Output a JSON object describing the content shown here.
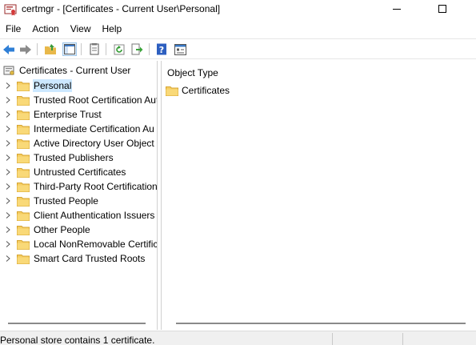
{
  "window": {
    "title": "certmgr - [Certificates - Current User\\Personal]"
  },
  "menu": [
    "File",
    "Action",
    "View",
    "Help"
  ],
  "toolbar": {
    "buttons": [
      "back-icon",
      "forward-icon",
      "up-folder-icon",
      "show-hide-console-tree-icon",
      "export-list-icon",
      "refresh-icon",
      "export-icon",
      "help-icon",
      "properties-icon"
    ]
  },
  "tree": {
    "root": "Certificates - Current User",
    "items": [
      {
        "label": "Personal",
        "selected": true
      },
      {
        "label": "Trusted Root Certification Aut"
      },
      {
        "label": "Enterprise Trust"
      },
      {
        "label": "Intermediate Certification Au"
      },
      {
        "label": "Active Directory User Object"
      },
      {
        "label": "Trusted Publishers"
      },
      {
        "label": "Untrusted Certificates"
      },
      {
        "label": "Third-Party Root Certification"
      },
      {
        "label": "Trusted People"
      },
      {
        "label": "Client Authentication Issuers"
      },
      {
        "label": "Other People"
      },
      {
        "label": "Local NonRemovable Certific"
      },
      {
        "label": "Smart Card Trusted Roots"
      }
    ]
  },
  "details": {
    "column_header": "Object Type",
    "items": [
      "Certificates"
    ]
  },
  "status": {
    "text": "Personal store contains 1 certificate."
  },
  "colors": {
    "selection": "#cce8ff",
    "folder": "#f5cd62",
    "folder_edge": "#d6a531"
  }
}
